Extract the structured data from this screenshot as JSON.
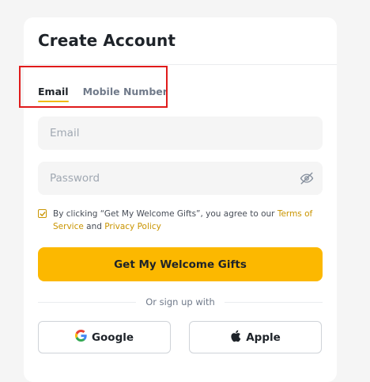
{
  "card": {
    "title": "Create Account"
  },
  "tabs": [
    {
      "label": "Email",
      "active": true
    },
    {
      "label": "Mobile Number",
      "active": false
    }
  ],
  "email_field": {
    "placeholder": "Email",
    "value": ""
  },
  "password_field": {
    "placeholder": "Password",
    "value": "",
    "icon": "eye-hidden-icon"
  },
  "terms": {
    "checked": true,
    "text_before": "By clicking “Get My Welcome Gifts”, you agree to our ",
    "terms_link": "Terms of Service",
    "and": " and ",
    "privacy_link": "Privacy Policy"
  },
  "primary_button": {
    "label": "Get My Welcome Gifts"
  },
  "divider": {
    "text": "Or sign up with"
  },
  "social": {
    "google": {
      "label": "Google",
      "icon": "google-icon"
    },
    "apple": {
      "label": "Apple",
      "icon": "apple-icon"
    }
  },
  "colors": {
    "accent": "#fcb800",
    "link": "#c99400",
    "highlight_box": "#e01b1b",
    "text_primary": "#1e2329",
    "text_secondary": "#707a8a"
  }
}
